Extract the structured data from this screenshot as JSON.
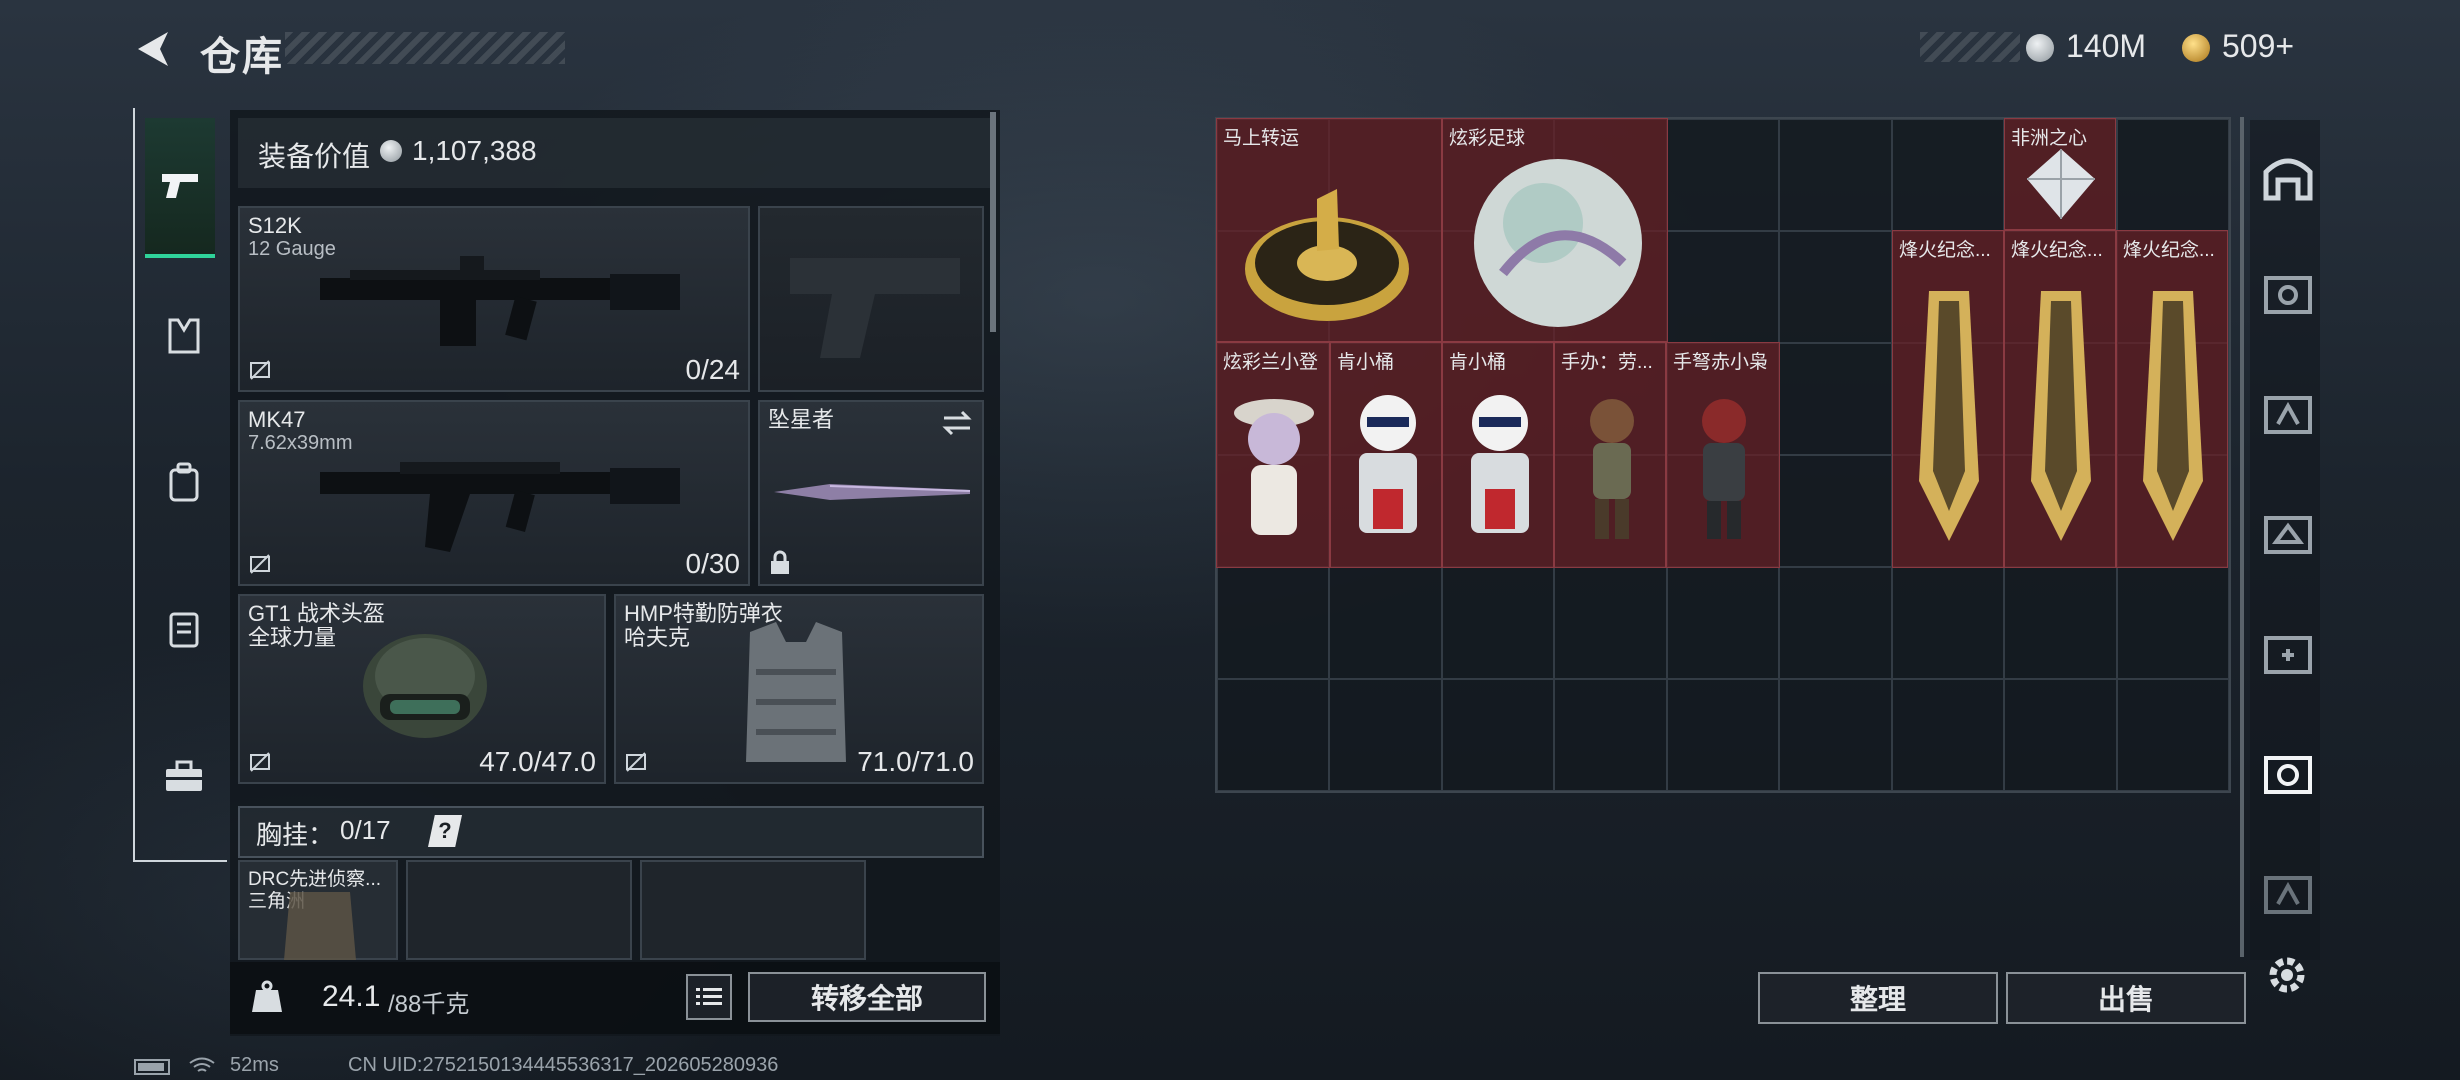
{
  "header": {
    "title": "仓库"
  },
  "currency": {
    "silver": "140M",
    "gold": "509+",
    "silver_color": "#c8ccd0",
    "gold_color": "#d9a844"
  },
  "left_nav": [
    "pistol-icon",
    "vest-icon",
    "backpack-icon",
    "clipboard-icon",
    "toolbox-icon"
  ],
  "loadout": {
    "value_label": "装备价值",
    "value": "1,107,388",
    "primary": {
      "name": "S12K",
      "sub": "12 Gauge",
      "ammo": "0/24"
    },
    "secondary": {
      "name": "MK47",
      "sub": "7.62x39mm",
      "ammo": "0/30"
    },
    "melee": {
      "name": "坠星者"
    },
    "helmet": {
      "name": "GT1 战术头盔",
      "sub": "全球力量",
      "durability": "47.0/47.0"
    },
    "armor": {
      "name": "HMP特勤防弹衣",
      "sub": "哈夫克",
      "durability": "71.0/71.0"
    },
    "chest_rig": {
      "label": "胸挂：",
      "count": "0/17",
      "help": "?"
    },
    "rig_item": {
      "name": "DRC先进侦察...",
      "sub": "三角洲"
    },
    "weight": "24.1",
    "weight_max": "/88千克",
    "transfer_all": "转移全部"
  },
  "stash": {
    "items": [
      {
        "name": "马上转运"
      },
      {
        "name": "炫彩足球"
      },
      {
        "name": "非洲之心"
      },
      {
        "name": "烽火纪念..."
      },
      {
        "name": "烽火纪念..."
      },
      {
        "name": "烽火纪念..."
      },
      {
        "name": "炫彩兰小登"
      },
      {
        "name": "肯小桶"
      },
      {
        "name": "肯小桶"
      },
      {
        "name": "手办：劳..."
      },
      {
        "name": "手弩赤小枭"
      }
    ],
    "sort_label": "整理",
    "sell_label": "出售"
  },
  "status": {
    "ping": "52ms",
    "uid": "CN UID:2752150134445536317_202605280936"
  }
}
